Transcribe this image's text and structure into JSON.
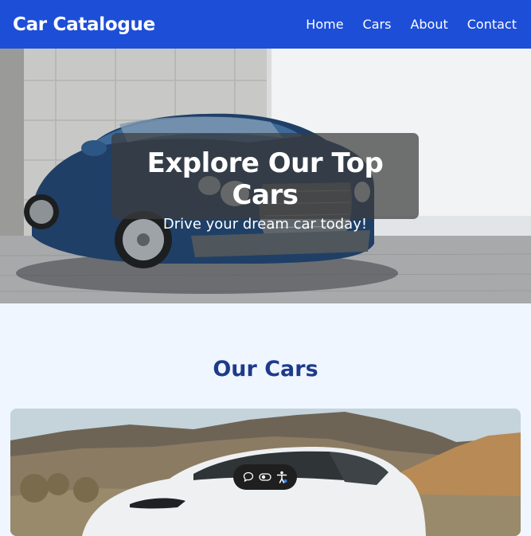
{
  "navbar": {
    "brand": "Car Catalogue",
    "links": [
      {
        "label": "Home"
      },
      {
        "label": "Cars"
      },
      {
        "label": "About"
      },
      {
        "label": "Contact"
      }
    ],
    "bg_color": "#1d4ed8"
  },
  "hero": {
    "title": "Explore Our Top Cars",
    "subtitle": "Drive your dream car today!",
    "image": "blue-luxury-coupe"
  },
  "section": {
    "title": "Our Cars"
  },
  "cars": [
    {
      "image": "white-electric-sedan-desert"
    }
  ],
  "floating_toolbar": {
    "icons": [
      "chat-bubble-icon",
      "toggle-icon",
      "accessibility-icon"
    ]
  },
  "colors": {
    "page_bg": "#eff6ff",
    "heading": "#1e3a8a"
  }
}
